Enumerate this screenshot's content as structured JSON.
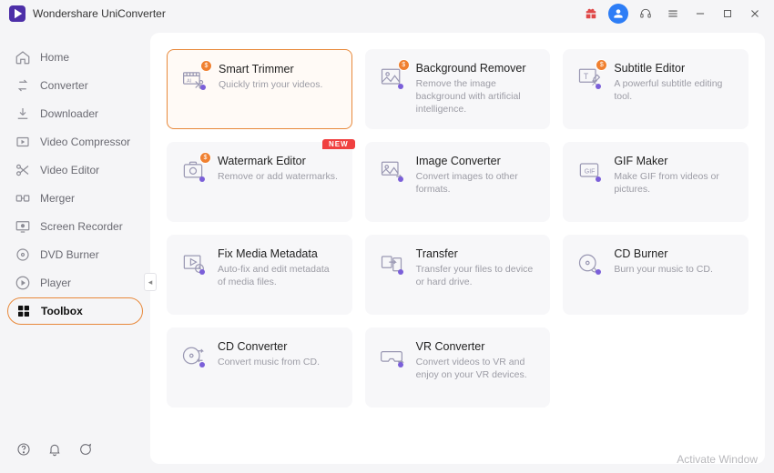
{
  "app": {
    "title": "Wondershare UniConverter"
  },
  "sidebar": {
    "items": [
      {
        "label": "Home"
      },
      {
        "label": "Converter"
      },
      {
        "label": "Downloader"
      },
      {
        "label": "Video Compressor"
      },
      {
        "label": "Video Editor"
      },
      {
        "label": "Merger"
      },
      {
        "label": "Screen Recorder"
      },
      {
        "label": "DVD Burner"
      },
      {
        "label": "Player"
      },
      {
        "label": "Toolbox"
      }
    ]
  },
  "tools": [
    {
      "title": "Smart Trimmer",
      "desc": "Quickly trim your videos.",
      "badge": "coin",
      "highlight": true
    },
    {
      "title": "Background Remover",
      "desc": "Remove the image background with artificial intelligence.",
      "badge": "coin"
    },
    {
      "title": "Subtitle Editor",
      "desc": "A powerful subtitle editing tool.",
      "badge": "coin"
    },
    {
      "title": "Watermark Editor",
      "desc": "Remove or add watermarks.",
      "badge": "coin",
      "tag": "NEW"
    },
    {
      "title": "Image Converter",
      "desc": "Convert images to other formats."
    },
    {
      "title": "GIF Maker",
      "desc": "Make GIF from videos or pictures."
    },
    {
      "title": "Fix Media Metadata",
      "desc": "Auto-fix and edit metadata of media files."
    },
    {
      "title": "Transfer",
      "desc": "Transfer your files to device or hard drive."
    },
    {
      "title": "CD Burner",
      "desc": "Burn your music to CD."
    },
    {
      "title": "CD Converter",
      "desc": "Convert music from CD."
    },
    {
      "title": "VR Converter",
      "desc": "Convert videos to VR and enjoy on your VR devices."
    }
  ],
  "watermark": "Activate Window"
}
